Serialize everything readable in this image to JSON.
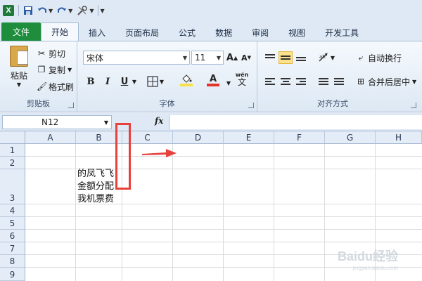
{
  "qat": {
    "icons": [
      "excel-logo",
      "save-icon",
      "undo-icon",
      "redo-icon",
      "tools-icon"
    ],
    "logo_letter": "X"
  },
  "tabs": [
    "文件",
    "开始",
    "插入",
    "页面布局",
    "公式",
    "数据",
    "审阅",
    "视图",
    "开发工具"
  ],
  "active_tab": "开始",
  "ribbon": {
    "clipboard": {
      "paste": "粘贴",
      "cut": "剪切",
      "copy": "复制",
      "format_painter": "格式刷",
      "label": "剪贴板"
    },
    "font": {
      "font_name": "宋体",
      "font_size": "11",
      "bold": "B",
      "italic": "I",
      "underline": "U",
      "grow": "A",
      "shrink": "A",
      "wen": "wén",
      "wen_char": "文",
      "label": "字体",
      "fill_color": "#f6e04b",
      "font_color": "#e3332d"
    },
    "alignment": {
      "wrap_text": "自动换行",
      "merge_center": "合并后居中",
      "label": "对齐方式"
    }
  },
  "formula_bar": {
    "name_box": "N12",
    "fx": "fx",
    "formula": ""
  },
  "grid": {
    "columns": [
      "A",
      "B",
      "C",
      "D",
      "E",
      "F",
      "G",
      "H"
    ],
    "rows": [
      "1",
      "2",
      "3",
      "4",
      "5",
      "6",
      "7",
      "8",
      "9"
    ],
    "cell_b3_lines": [
      "的凤飞飞",
      "金额分配",
      "我机票费"
    ]
  },
  "annotation": {
    "highlight_color": "#e8413c"
  },
  "watermark": {
    "text": "Baidu经验",
    "url": "jingyan.baidu.com"
  }
}
